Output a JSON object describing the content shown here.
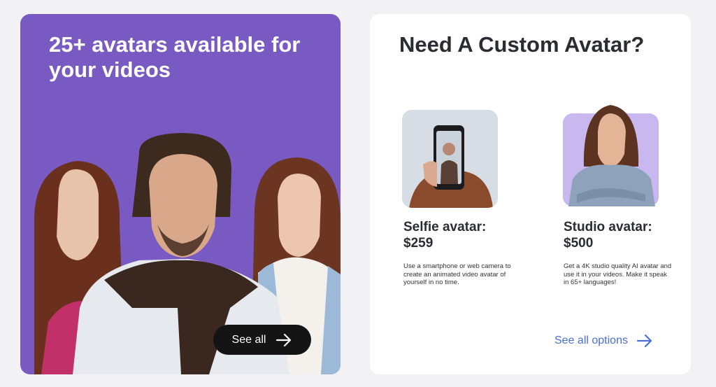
{
  "left_card": {
    "title": "25+ avatars available for your videos",
    "button_label": "See all",
    "colors": {
      "background": "#785ac2",
      "button": "#141414"
    }
  },
  "right_card": {
    "title": "Need A Custom Avatar?",
    "options": [
      {
        "name": "Selfie avatar: $259",
        "description": "Use a smartphone or web camera to create an animated video avatar of yourself in no time."
      },
      {
        "name": "Studio avatar: $500",
        "description": "Get a 4K studio quality AI avatar and use it in your videos. Make it speak in 65+ languages!"
      }
    ],
    "link_label": "See all options",
    "colors": {
      "link": "#4a6fd6"
    }
  },
  "icons": [
    "arrow-right-icon"
  ]
}
